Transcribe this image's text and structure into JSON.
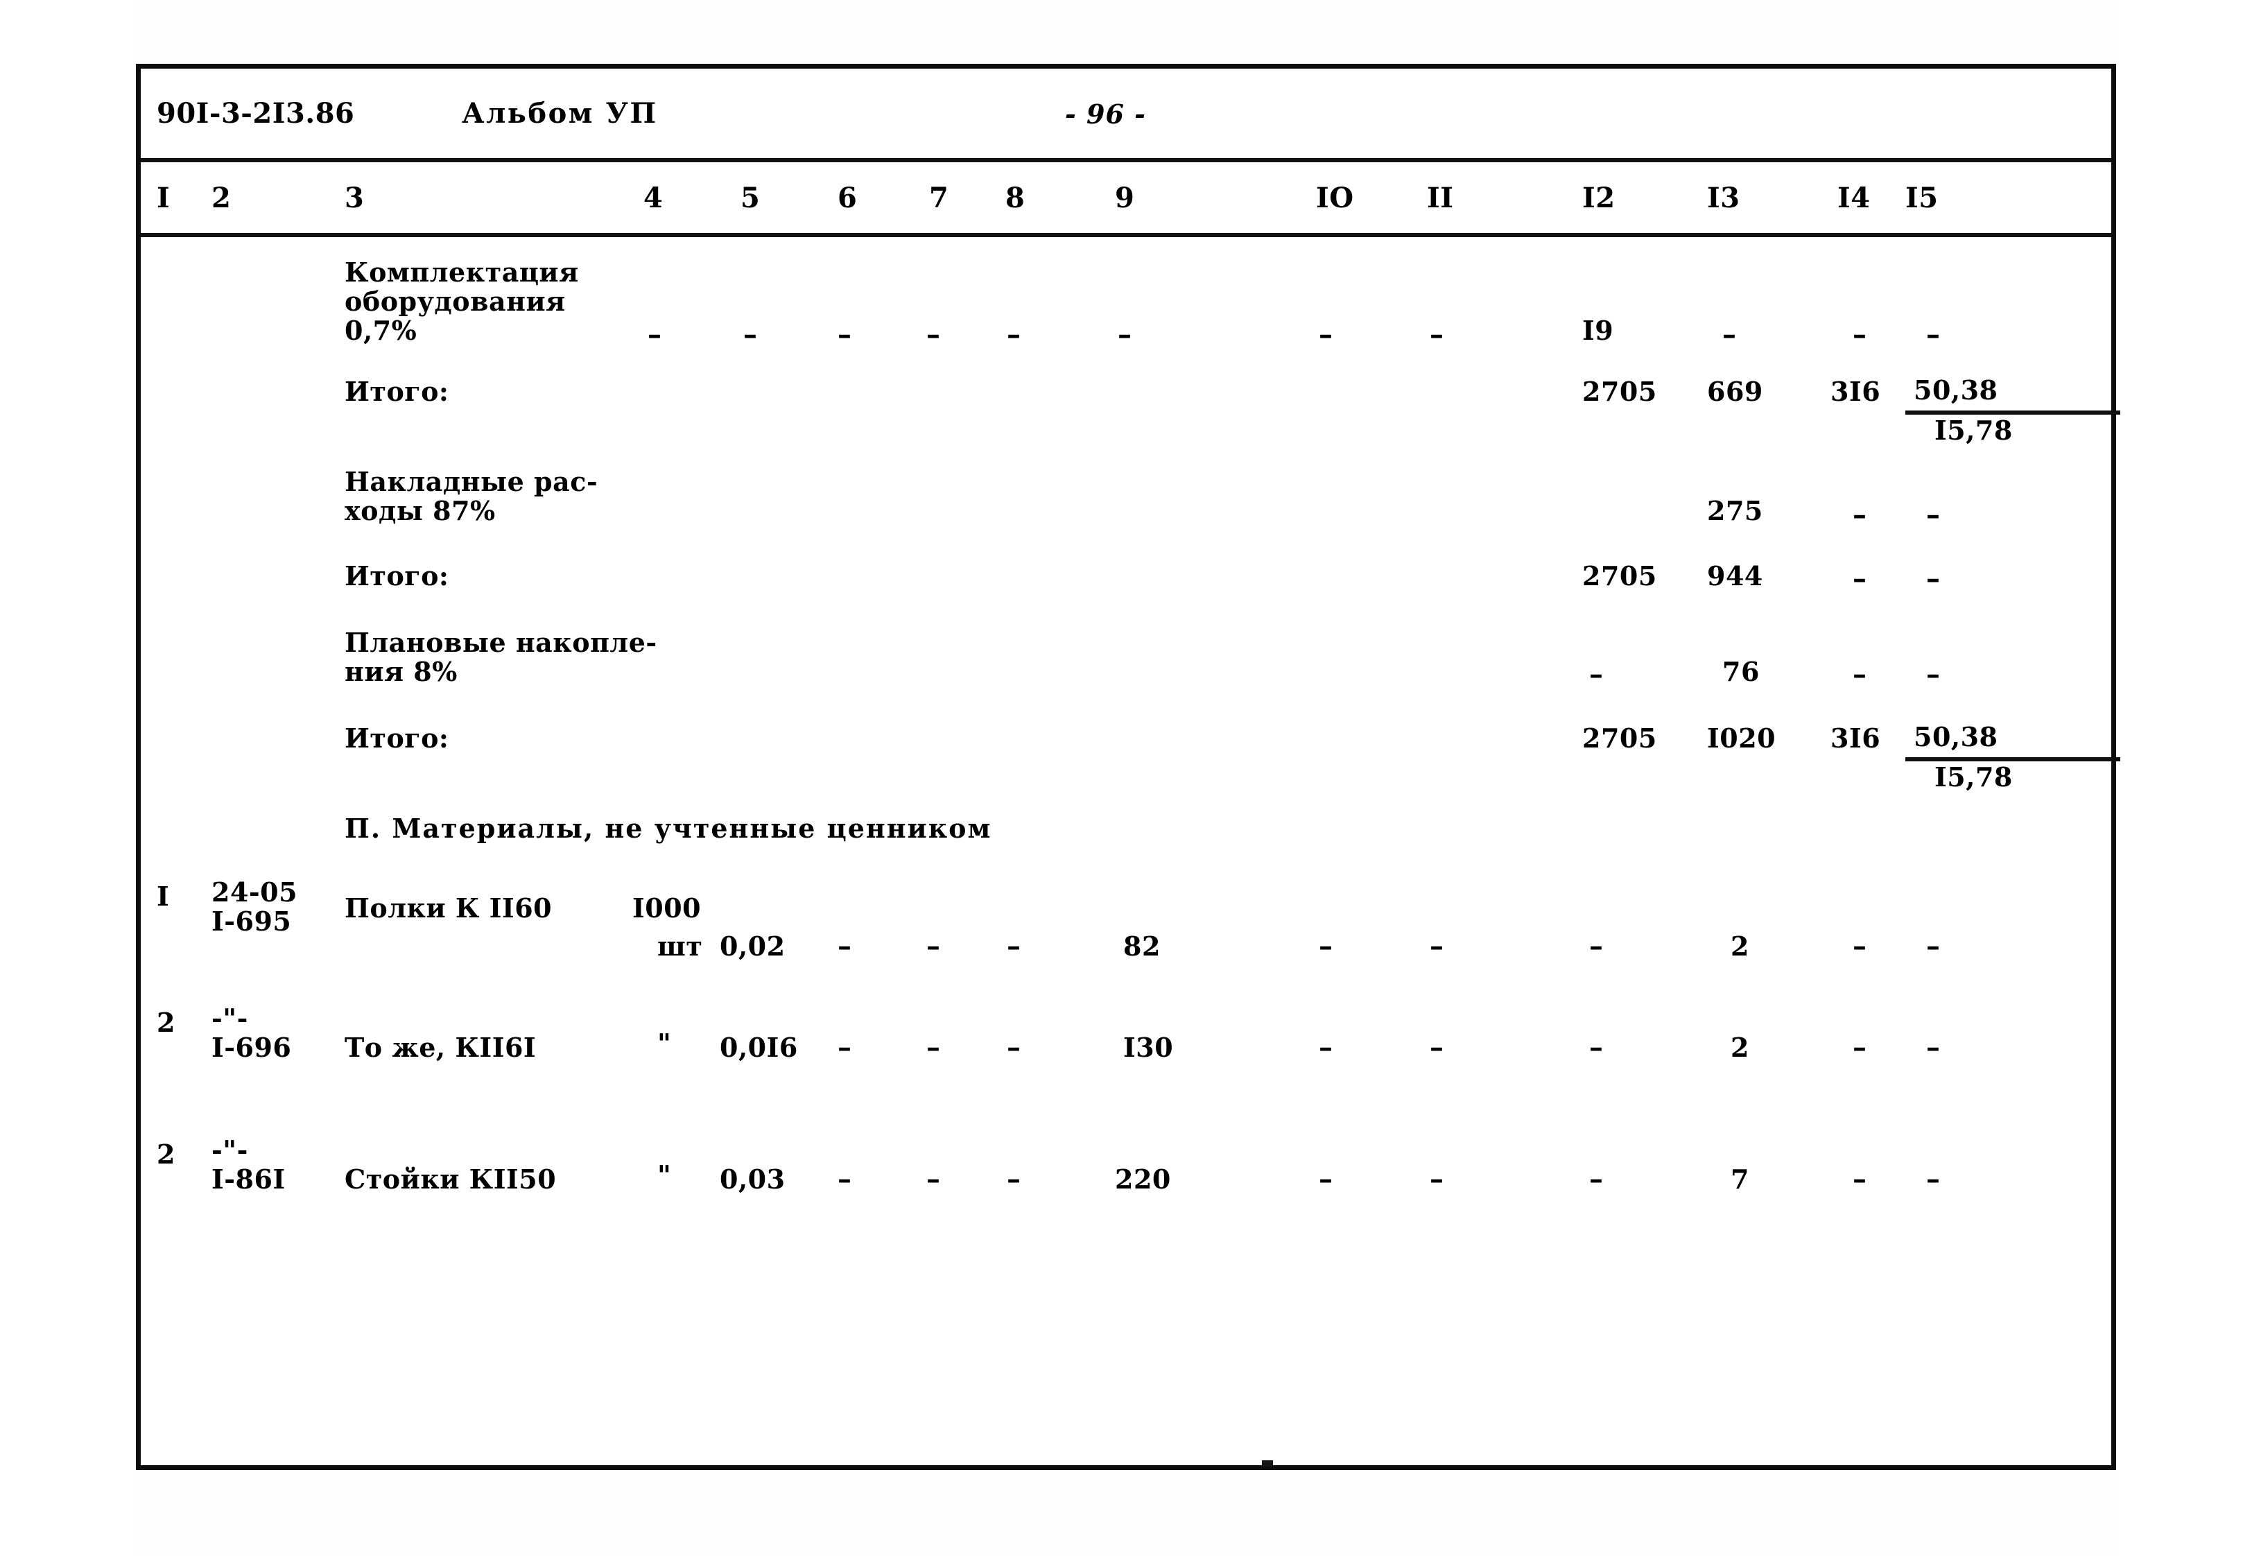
{
  "document": {
    "code": "90I-3-2I3.86",
    "album_label": "Альбом УП",
    "page_number": "- 96 -"
  },
  "table": {
    "column_headers": [
      "I",
      "2",
      "3",
      "4",
      "5",
      "6",
      "7",
      "8",
      "9",
      "IO",
      "II",
      "I2",
      "I3",
      "I4",
      "I5"
    ],
    "rows": [
      {
        "name": "row-komplektaciya",
        "c1": "",
        "c2": "",
        "c3_lines": [
          "Комплектация",
          "оборудования",
          "0,7%"
        ],
        "c4": "",
        "c5": "–",
        "c6": "–",
        "c7": "–",
        "c8": "–",
        "c9": "–",
        "c10": "–",
        "c11": "–",
        "c12": "I9",
        "c13": "–",
        "c14": "–",
        "c15": "–",
        "c4_dash": "–"
      },
      {
        "name": "row-itogo-1",
        "c3": "Итого:",
        "c12": "2705",
        "c13": "669",
        "c14": "3I6",
        "c15_top": "50,38",
        "c15_bottom": "I5,78"
      },
      {
        "name": "row-nakladnye",
        "c3_lines": [
          "Накладные рас-",
          "ходы 87%"
        ],
        "c13": "275",
        "c14": "–",
        "c15": "–"
      },
      {
        "name": "row-itogo-2",
        "c3": "Итого:",
        "c12": "2705",
        "c13": "944",
        "c14": "–",
        "c15": "–"
      },
      {
        "name": "row-planovye",
        "c3_lines": [
          "Плановые накопле-",
          "ния 8%"
        ],
        "c12": "–",
        "c13": "76",
        "c14": "–",
        "c15": "–"
      },
      {
        "name": "row-itogo-3",
        "c3": "Итого:",
        "c12": "2705",
        "c13": "I020",
        "c14": "3I6",
        "c15_top": "50,38",
        "c15_bottom": "I5,78"
      }
    ],
    "section_title": "П. Материалы, не учтенные ценником",
    "material_rows": [
      {
        "name": "row-polki-k1160",
        "c1": "I",
        "c2_line1": "24-05",
        "c2_line2": "I-695",
        "c3": "Полки К II60",
        "c4_line1": "I000",
        "c4_line2": "шт",
        "c5": "0,02",
        "c6": "–",
        "c7": "–",
        "c8": "–",
        "c9": "82",
        "c10": "–",
        "c11": "–",
        "c12": "–",
        "c13": "2",
        "c14": "–",
        "c15": "–"
      },
      {
        "name": "row-tozhe-k1161",
        "c1": "2",
        "c2_line1": "-\"-",
        "c2_line2": "I-696",
        "c3": "То же, КII6I",
        "c4_line1": "",
        "c4_line2": "\"",
        "c5": "0,0I6",
        "c6": "–",
        "c7": "–",
        "c8": "–",
        "c9": "I30",
        "c10": "–",
        "c11": "–",
        "c12": "–",
        "c13": "2",
        "c14": "–",
        "c15": "–"
      },
      {
        "name": "row-stoyki-k1150",
        "c1": "2",
        "c2_line1": "-\"-",
        "c2_line2": "I-86I",
        "c3": "Стойки КII50",
        "c4_line1": "",
        "c4_line2": "\"",
        "c5": "0,03",
        "c6": "–",
        "c7": "–",
        "c8": "–",
        "c9": "220",
        "c10": "–",
        "c11": "–",
        "c12": "–",
        "c13": "7",
        "c14": "–",
        "c15": "–"
      }
    ]
  }
}
